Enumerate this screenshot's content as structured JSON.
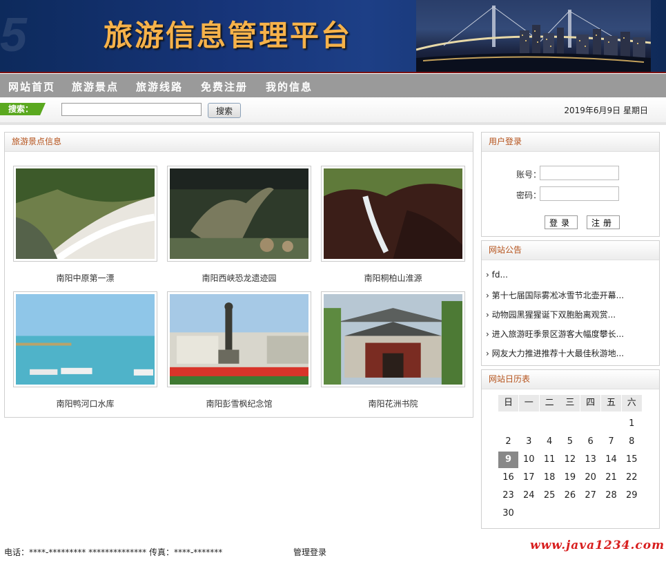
{
  "banner": {
    "title": "旅游信息管理平台"
  },
  "nav": {
    "items": [
      "网站首页",
      "旅游景点",
      "旅游线路",
      "免费注册",
      "我的信息"
    ]
  },
  "search": {
    "label": "搜索：",
    "value": "",
    "button": "搜索"
  },
  "date": "2019年6月9日 星期日",
  "scenic": {
    "heading": "旅游景点信息",
    "items": [
      {
        "name": "南阳中原第一漂"
      },
      {
        "name": "南阳西峡恐龙遗迹园"
      },
      {
        "name": "南阳桐柏山淮源"
      },
      {
        "name": "南阳鸭河口水库"
      },
      {
        "name": "南阳彭雪枫纪念馆"
      },
      {
        "name": "南阳花洲书院"
      }
    ]
  },
  "login": {
    "heading": "用户登录",
    "account_label": "账号：",
    "password_label": "密码：",
    "login_button": "登录",
    "register_button": "注册"
  },
  "notice": {
    "heading": "网站公告",
    "items": [
      "fd...",
      "第十七届国际雾凇冰雪节北壶开幕...",
      "动物园黑猩猩诞下双胞胎离观赏...",
      "进入旅游旺季景区游客大幅度攀长...",
      "网友大力推进推荐十大最佳秋游地..."
    ]
  },
  "calendar": {
    "heading": "网站日历表",
    "weekdays": [
      "日",
      "一",
      "二",
      "三",
      "四",
      "五",
      "六"
    ],
    "first_weekday_index": 6,
    "days_in_month": 30,
    "today": 9
  },
  "footer": {
    "contact": "电话：****-********* ************** 传真：****-*******",
    "admin_link": "管理登录",
    "watermark": "www.java1234.com"
  },
  "colors": {
    "accent": "#b5521b",
    "nav_bg": "#9a9a9a",
    "search_label_bg": "#5aa81f",
    "banner_title": "#f6b24a"
  }
}
